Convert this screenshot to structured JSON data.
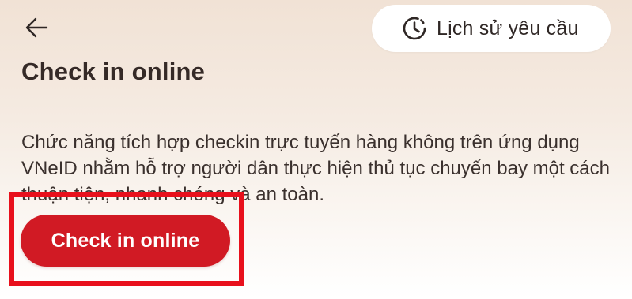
{
  "header": {
    "back_icon": "arrow-left-icon",
    "history_button": {
      "icon": "clock-history-icon",
      "label": "Lịch sử yêu cầu"
    }
  },
  "main": {
    "title": "Check in online",
    "description": "Chức năng tích hợp checkin trực tuyến hàng không trên ứng dụng VNeID nhằm hỗ trợ người dân thực hiện thủ tục chuyến bay một cách thuận tiện, nhanh chóng và an toàn.",
    "primary_button_label": "Check in online"
  },
  "colors": {
    "primary": "#d11a24",
    "highlight": "#e8101c",
    "text": "#352a27"
  }
}
